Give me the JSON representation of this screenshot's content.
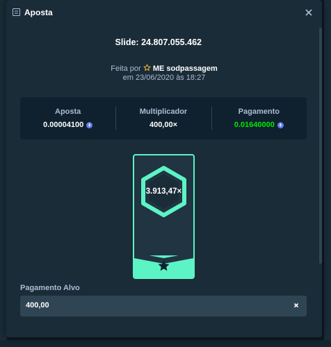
{
  "modal": {
    "title": "Aposta",
    "title_icon": "receipt-icon",
    "close_icon": "close-icon"
  },
  "bet": {
    "game_label": "Slide:",
    "bet_id": "24.807.055.462",
    "share_icons": [
      "copy-icon",
      "facebook-icon",
      "twitter-icon"
    ],
    "made_by_prefix": "Feita por",
    "user_icon": "star-icon",
    "username": "ME sodpassagem",
    "date_line": "em 23/06/2020 às 18:27"
  },
  "stats": {
    "bet_label": "Aposta",
    "bet_value": "0.00004100",
    "multiplier_label": "Multiplicador",
    "multiplier_value": "400,00×",
    "payout_label": "Pagamento",
    "payout_value": "0.01640000",
    "currency_icon": "eth-coin-icon"
  },
  "result_card": {
    "multiplier": "3.913,47×",
    "badge_icon": "star-icon"
  },
  "target": {
    "label": "Pagamento Alvo",
    "value": "400,00",
    "suffix": "×"
  },
  "colors": {
    "background": "#1a2c38",
    "panel": "#0f212e",
    "accent": "#5df4c5",
    "payout_green": "#00e701",
    "eth": "#627eea"
  }
}
